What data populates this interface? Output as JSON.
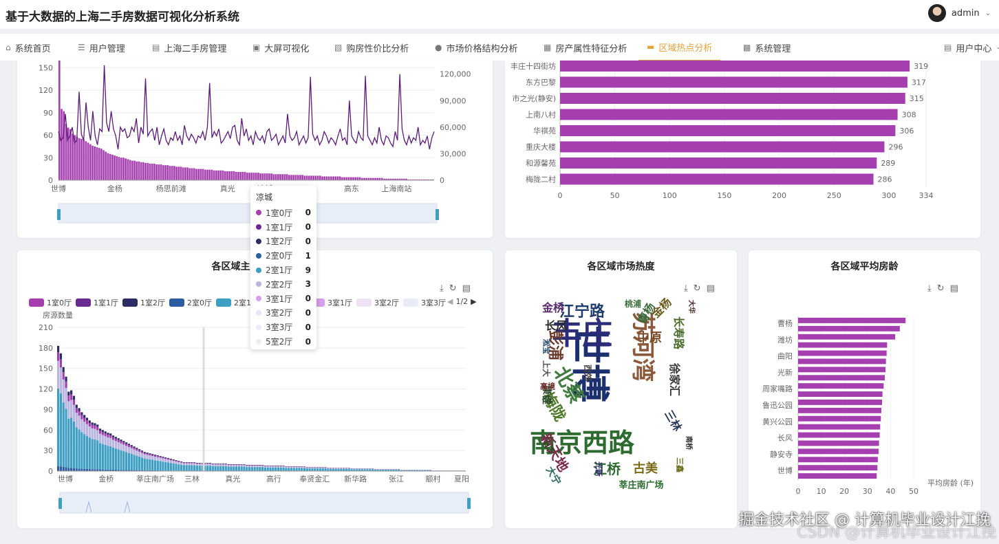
{
  "app": {
    "title": "基于大数据的上海二手房数据可视化分析系统",
    "user": "admin"
  },
  "nav": {
    "items": [
      {
        "label": "系统首页",
        "icon": "home-icon"
      },
      {
        "label": "用户管理",
        "icon": "list-icon"
      },
      {
        "label": "上海二手房管理",
        "icon": "briefcase-icon"
      },
      {
        "label": "大屏可视化",
        "icon": "screen-icon"
      },
      {
        "label": "购房性价比分析",
        "icon": "ticket-icon"
      },
      {
        "label": "市场价格结构分析",
        "icon": "pin-icon"
      },
      {
        "label": "房产属性特征分析",
        "icon": "building-icon"
      },
      {
        "label": "区域热点分析",
        "icon": "stack-icon"
      },
      {
        "label": "系统管理",
        "icon": "bar-icon"
      }
    ],
    "user_center": "用户中心"
  },
  "cards": {
    "mix_title": "各区域主力户型分布",
    "heat_title": "各区域市场热度",
    "age_title": "各区域平均房龄"
  },
  "tooltip": {
    "title": "凉城",
    "rows": [
      {
        "label": "1室0厅",
        "value": "0",
        "color": "#a53fb0"
      },
      {
        "label": "1室1厅",
        "value": "0",
        "color": "#6a2a91"
      },
      {
        "label": "1室2厅",
        "value": "0",
        "color": "#2b2d63"
      },
      {
        "label": "2室0厅",
        "value": "1",
        "color": "#2c5da2"
      },
      {
        "label": "2室1厅",
        "value": "9",
        "color": "#3f9fc2"
      },
      {
        "label": "2室2厅",
        "value": "3",
        "color": "#b9b5e0"
      },
      {
        "label": "3室1厅",
        "value": "0",
        "color": "#d6a0e8"
      },
      {
        "label": "3室2厅",
        "value": "0",
        "color": "#ede3f5"
      },
      {
        "label": "3室3厅",
        "value": "0",
        "color": "#e9ecf6"
      },
      {
        "label": "5室2厅",
        "value": "0",
        "color": "#eeeeee"
      }
    ]
  },
  "legend": {
    "items": [
      {
        "label": "1室0厅",
        "color": "#a53fb0"
      },
      {
        "label": "1室1厅",
        "color": "#6a2a91"
      },
      {
        "label": "1室2厅",
        "color": "#2b2d63"
      },
      {
        "label": "2室0厅",
        "color": "#2c5da2"
      },
      {
        "label": "2室1厅",
        "color": "#3f9fc2"
      },
      {
        "label": "3室1厅",
        "color": "#d6a0e8"
      },
      {
        "label": "3室2厅",
        "color": "#ede3f5"
      },
      {
        "label": "3室3厅",
        "color": "#e9ecf6"
      }
    ],
    "page": "1/2"
  },
  "wordcloud": [
    {
      "text": "世博",
      "size": 56,
      "color": "#1c2f6e"
    },
    {
      "text": "丰庄",
      "size": 44,
      "color": "#2b2d7a"
    },
    {
      "text": "南京西路",
      "size": 38,
      "color": "#2e6b30"
    },
    {
      "text": "苏河湾",
      "size": 34,
      "color": "#8a5a3a"
    },
    {
      "text": "北蔡",
      "size": 28,
      "color": "#3f7a3f"
    },
    {
      "text": "江宁路",
      "size": 22,
      "color": "#1f3b6b"
    },
    {
      "text": "彭浦",
      "size": 22,
      "color": "#6b3a2a"
    },
    {
      "text": "梅陇",
      "size": 22,
      "color": "#4f7a2a"
    },
    {
      "text": "新天地",
      "size": 20,
      "color": "#7a2a4a"
    },
    {
      "text": "江桥",
      "size": 20,
      "color": "#2e6b30"
    },
    {
      "text": "古美",
      "size": 18,
      "color": "#7a6a1a"
    },
    {
      "text": "中原",
      "size": 18,
      "color": "#7a4a2a"
    },
    {
      "text": "金桥",
      "size": 16,
      "color": "#5a2a6b"
    },
    {
      "text": "长风",
      "size": 16,
      "color": "#2a2a2a"
    },
    {
      "text": "徐家汇",
      "size": 16,
      "color": "#3a3a3a"
    },
    {
      "text": "长寿路",
      "size": 16,
      "color": "#4a6b2a"
    },
    {
      "text": "金杨",
      "size": 16,
      "color": "#6b5a1a"
    },
    {
      "text": "曹杨",
      "size": 16,
      "color": "#3a6b3a"
    },
    {
      "text": "三林",
      "size": 16,
      "color": "#2a3a5a"
    },
    {
      "text": "莘庄南广场",
      "size": 13,
      "color": "#2e6b30"
    },
    {
      "text": "康健",
      "size": 14,
      "color": "#2e4a2e"
    },
    {
      "text": "大宁",
      "size": 14,
      "color": "#2a6b5a"
    },
    {
      "text": "西郊",
      "size": 12,
      "color": "#444"
    },
    {
      "text": "上大",
      "size": 12,
      "color": "#555"
    },
    {
      "text": "高境",
      "size": 11,
      "color": "#6b2a2a"
    },
    {
      "text": "淞宝",
      "size": 11,
      "color": "#2a4a6b"
    },
    {
      "text": "桃浦",
      "size": 12,
      "color": "#3a6b3a"
    },
    {
      "text": "光新",
      "size": 11,
      "color": "#2a2a6b"
    },
    {
      "text": "三鑫",
      "size": 11,
      "color": "#6b6b1a"
    },
    {
      "text": "南桥",
      "size": 10,
      "color": "#2a2a2a"
    },
    {
      "text": "合庆",
      "size": 10,
      "color": "#2a4a2a"
    },
    {
      "text": "大华",
      "size": 10,
      "color": "#4a2a2a"
    }
  ],
  "chart_data": [
    {
      "type": "line",
      "title": "",
      "note": "bars: listing count per area (left axis); line: average unit price (right axis); partially scrolled out of view",
      "x_labels": [
        "世博",
        "金杨",
        "杨思前滩",
        "真光",
        "凉城",
        "高东",
        "上海南站"
      ],
      "y_left_ticks": [
        0,
        30,
        60,
        90,
        120,
        150
      ],
      "y_right_ticks": [
        "0",
        "30,000",
        "60,000",
        "90,000",
        "120,000"
      ],
      "bar_values": [
        180,
        95,
        92,
        75,
        70,
        68,
        62,
        60,
        58,
        56,
        55,
        54,
        52,
        50,
        48,
        46,
        45,
        44,
        43,
        42,
        40,
        38,
        36,
        35,
        34,
        33,
        32,
        31,
        30,
        30,
        29,
        28,
        27,
        26,
        26,
        25,
        25,
        24,
        24,
        23,
        23,
        22,
        22,
        22,
        21,
        21,
        21,
        20,
        20,
        20,
        19,
        19,
        19,
        18,
        18,
        18,
        17,
        17,
        17,
        16,
        16,
        16,
        15,
        15,
        15,
        15,
        14,
        14,
        14,
        14,
        13,
        13,
        13,
        13,
        13,
        12,
        12,
        12,
        12,
        12,
        11,
        11,
        11,
        11,
        11,
        10,
        10,
        10,
        10,
        10,
        10,
        9,
        9,
        9,
        9,
        9,
        9,
        8,
        8,
        8,
        8,
        8,
        8,
        8,
        7,
        7,
        7,
        7,
        7,
        7,
        7,
        6,
        6,
        6,
        6,
        6,
        6,
        6,
        6,
        5,
        5,
        5,
        5,
        5,
        5,
        5,
        5,
        5,
        4,
        4,
        4,
        4,
        4,
        4,
        4,
        4,
        4,
        3,
        3,
        3,
        3,
        3,
        3,
        3,
        3,
        3,
        3,
        2,
        2,
        2,
        2,
        2,
        2,
        2,
        2,
        2,
        2,
        2,
        1,
        1,
        1,
        1,
        1,
        1,
        1,
        1,
        1,
        1,
        1,
        1
      ],
      "line_values": [
        55000,
        45000,
        48000,
        75000,
        45000,
        50000,
        60000,
        42000,
        45000,
        100000,
        52000,
        45000,
        88000,
        60000,
        45000,
        78000,
        50000,
        40000,
        58000,
        55000,
        130000,
        65000,
        55000,
        78000,
        58000,
        50000,
        35000,
        60000,
        55000,
        58000,
        48000,
        50000,
        60000,
        55000,
        70000,
        42000,
        60000,
        52000,
        115000,
        50000,
        55000,
        58000,
        45000,
        60000,
        40000,
        50000,
        58000,
        45000,
        40000,
        48000,
        45000,
        55000,
        45000,
        50000,
        40000,
        62000,
        50000,
        45000,
        52000,
        48000,
        42000,
        50000,
        48000,
        55000,
        45000,
        60000,
        110000,
        48000,
        55000,
        50000,
        58000,
        42000,
        45000,
        50000,
        55000,
        47000,
        60000,
        62000,
        45000,
        40000,
        70000,
        50000,
        58000,
        45000,
        50000,
        40000,
        55000,
        48000,
        45000,
        50000,
        42000,
        55000,
        58000,
        45000,
        48000,
        52000,
        40000,
        45000,
        50000,
        42000,
        75000,
        50000,
        45000,
        48000,
        55000,
        40000,
        45000,
        50000,
        42000,
        48000,
        117000,
        52000,
        45000,
        50000,
        40000,
        45000,
        55000,
        50000,
        42000,
        48000,
        45000,
        40000,
        50000,
        58000,
        45000,
        48000,
        40000,
        90000,
        50000,
        45000,
        42000,
        55000,
        48000,
        45000,
        118000,
        50000,
        45000,
        40000,
        48000,
        42000,
        60000,
        45000,
        40000,
        50000,
        48000,
        42000,
        38000,
        55000,
        45000,
        120000,
        58000,
        45000,
        40000,
        50000,
        42000,
        48000,
        45000,
        60000,
        40000,
        45000,
        42000,
        50000,
        35000,
        48000,
        55000
      ],
      "slider": "dataZoom"
    },
    {
      "type": "bar",
      "orientation": "horizontal",
      "title": "",
      "categories": [
        "丰庄十四街坊",
        "东方巴黎",
        "市之光(静安)",
        "上南八村",
        "华祺苑",
        "重庆大楼",
        "和源馨苑",
        "梅陇二村"
      ],
      "values": [
        319,
        317,
        315,
        308,
        306,
        296,
        289,
        286
      ],
      "x_ticks": [
        0,
        50,
        100,
        150,
        200,
        250,
        300,
        334
      ],
      "xlim": [
        0,
        334
      ]
    },
    {
      "type": "bar",
      "stacked": true,
      "title": "各区域主力户型分布",
      "ylabel": "房源数量",
      "y_ticks": [
        0,
        30,
        60,
        90,
        120,
        150,
        180,
        210
      ],
      "x_labels": [
        "世博",
        "金桥",
        "莘庄南广场",
        "三林",
        "真光",
        "高行",
        "奉贤金汇",
        "新华路",
        "张江",
        "颛村",
        "夏阳"
      ],
      "series_names": [
        "1室0厅",
        "1室1厅",
        "1室2厅",
        "2室0厅",
        "2室1厅",
        "2室2厅",
        "3室1厅",
        "3室2厅",
        "3室3厅",
        "5室2厅"
      ],
      "totals": [
        183,
        172,
        152,
        138,
        116,
        118,
        110,
        97,
        92,
        86,
        82,
        78,
        74,
        71,
        70,
        68,
        62,
        60,
        58,
        56,
        55,
        52,
        50,
        48,
        46,
        44,
        42,
        40,
        38,
        36,
        34,
        32,
        30,
        28,
        27,
        26,
        25,
        24,
        23,
        22,
        21,
        20,
        19,
        18,
        17,
        16,
        15,
        14,
        13,
        13,
        13,
        13,
        13,
        12,
        12,
        12,
        12,
        12,
        12,
        11,
        11,
        11,
        11,
        11,
        11,
        10,
        10,
        10,
        10,
        10,
        10,
        10,
        9,
        9,
        9,
        9,
        9,
        9,
        9,
        8,
        8,
        8,
        8,
        8,
        8,
        8,
        8,
        7,
        7,
        7,
        7,
        7,
        7,
        7,
        7,
        6,
        6,
        6,
        6,
        6,
        6,
        6,
        6,
        5,
        5,
        5,
        5,
        5,
        5,
        5,
        5,
        5,
        4,
        4,
        4,
        4,
        4,
        4,
        4,
        4,
        4,
        3,
        3,
        3,
        3,
        3,
        3,
        3,
        3,
        3,
        3,
        2,
        2,
        2,
        2,
        2,
        2,
        2,
        2,
        2,
        2,
        2,
        2,
        1,
        1,
        1,
        1,
        1,
        1,
        1,
        1,
        1,
        1,
        1,
        1,
        1
      ],
      "hover_category": "凉城"
    },
    {
      "type": "bar",
      "orientation": "horizontal",
      "title": "各区域平均房龄",
      "xlabel": "平均房龄 (年)",
      "categories": [
        "曹杨",
        "潍坊",
        "曲阳",
        "光新",
        "周家嘴路",
        "鲁迅公园",
        "黄兴公园",
        "长风",
        "静安寺",
        "世博"
      ],
      "values": [
        46.5,
        44,
        42,
        38.5,
        38.3,
        38,
        37.8,
        37.5,
        37,
        36.5,
        36.3,
        36,
        35.8,
        35.5,
        35.3,
        35,
        34.8,
        34.5,
        34.3,
        34
      ],
      "x_ticks": [
        0,
        10,
        20,
        30,
        40,
        50
      ],
      "xlim": [
        0,
        50
      ]
    }
  ],
  "watermark": "掘金技术社区 @ 计算机毕业设计江挽",
  "watermark2": "CSDN @计算机毕业设计江挽"
}
